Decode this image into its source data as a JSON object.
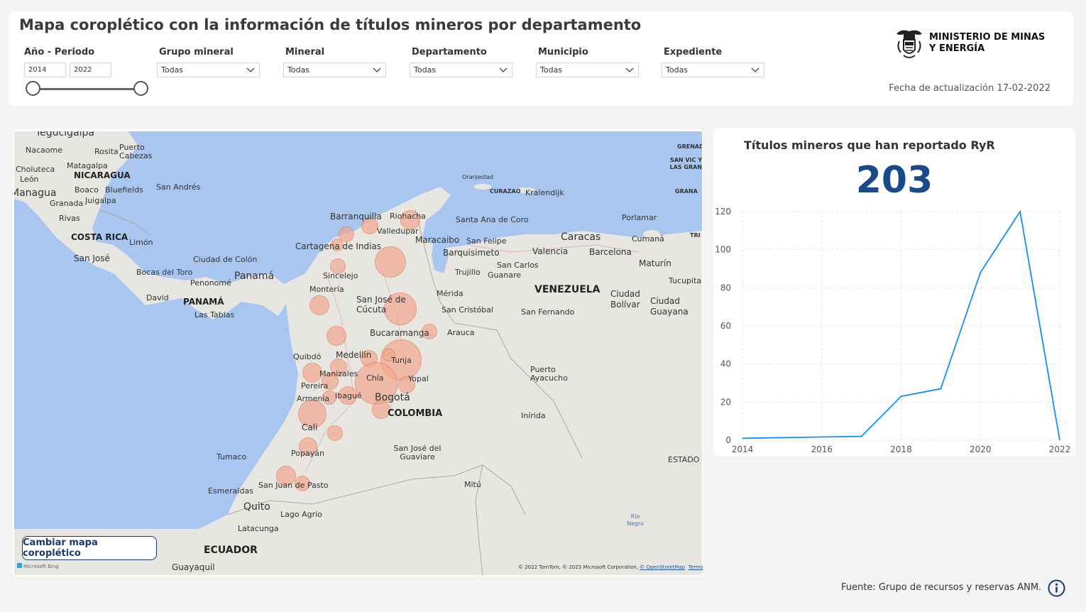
{
  "header": {
    "title": "Mapa coroplético con la información de títulos mineros por departamento",
    "ministry": "MINISTERIO DE MINAS Y ENERGÍA",
    "ministry_line1": "MINISTERIO DE MINAS",
    "ministry_line2": "Y ENERGÍA",
    "update_date": "Fecha de actualización 17-02-2022"
  },
  "filters": {
    "period_label": "Año - Periodo",
    "period_from": "2014",
    "period_to": "2022",
    "grupo_label": "Grupo mineral",
    "grupo_value": "Todas",
    "mineral_label": "Mineral",
    "mineral_value": "Todas",
    "departamento_label": "Departamento",
    "departamento_value": "Todas",
    "municipio_label": "Municipio",
    "municipio_value": "Todas",
    "expediente_label": "Expediente",
    "expediente_value": "Todas"
  },
  "map": {
    "switch_button": "Cambiar mapa coroplético",
    "bing_label": "Microsoft Bing",
    "attribution": "© 2022 TomTom, © 2023 Microsoft Corporation,",
    "osm_link": "© OpenStreetMap",
    "terms_link": "Terms",
    "bubble_color": "#f4a58a",
    "labels": {
      "tegucigalpa": "Tegucigalpa",
      "nacaome": "Nacaome",
      "rosita": "Rosita",
      "puerto_cabezas": "Puerto Cabezas",
      "choluteca": "Choluteca",
      "matagalpa": "Matagalpa",
      "leon": "León",
      "nicaragua": "NICARAGUA",
      "managua": "Managua",
      "boaco": "Boaco",
      "bluefields": "Bluefields",
      "san_andres": "San Andrés",
      "granada": "Granada",
      "juigalpa": "Juigalpa",
      "rivas": "Rivas",
      "costa_rica": "COSTA RICA",
      "limon": "Limón",
      "san_jose_cr": "San José",
      "ciudad_colon": "Ciudad de Colón",
      "bocas": "Bocas del Toro",
      "panama_city": "Panamá",
      "penonome": "Penonomé",
      "david": "David",
      "panama": "PANAMÁ",
      "las_tablas": "Las Tablas",
      "oranjestad": "Oranjestad",
      "curazao": "CURAZAO",
      "kralendijk": "Kralendijk",
      "barranquilla": "Barranquilla",
      "riohacha": "Riohacha",
      "valledupar": "Valledupar",
      "santa_ana": "Santa Ana de Coro",
      "maracaibo": "Maracaibo",
      "cartagena": "Cartagena de Indias",
      "san_felipe": "San Felipe",
      "barquisimeto": "Barquisimeto",
      "caracas": "Caracas",
      "valencia": "Valencia",
      "barcelona": "Barcelona",
      "cumana": "Cumaná",
      "porlamar": "Porlamar",
      "sincelejo": "Sincelejo",
      "san_carlos": "San Carlos",
      "trujillo": "Trujillo",
      "guanare": "Guanare",
      "maturin": "Maturín",
      "monteria": "Montería",
      "merida": "Mérida",
      "venezuela": "VENEZUELA",
      "ciudad_bolivar": "Ciudad Bolívar",
      "tucupita": "Tucupita",
      "ciudad_guayana": "Ciudad Guayana",
      "san_jose_cucuta": "San José de Cúcuta",
      "san_cristobal": "San Cristóbal",
      "san_fernando": "San Fernando",
      "bucaramanga": "Bucaramanga",
      "arauca": "Arauca",
      "quibdo": "Quibdó",
      "medellin": "Medellín",
      "tunja": "Tunja",
      "manizales": "Manizales",
      "puerto_ayacucho": "Puerto Ayacucho",
      "pereira": "Pereira",
      "chia": "Chía",
      "yopal": "Yopal",
      "armenia": "Armenia",
      "ibague": "Ibagué",
      "bogota": "Bogotá",
      "colombia": "COLOMBIA",
      "inirida": "Inírida",
      "cali": "Cali",
      "tumaco": "Tumaco",
      "popayan": "Popayán",
      "san_jose_guaviare": "San José del Guaviare",
      "estado": "ESTADO",
      "pasto": "San Juan de Pasto",
      "mitu": "Mitú",
      "esmeraldas": "Esmeraldas",
      "quito": "Quito",
      "lago_agrio": "Lago Agrio",
      "rio_negro": "Río Negro",
      "latacunga": "Latacunga",
      "ecuador": "ECUADOR",
      "guayaquil": "Guayaquil",
      "san_vicente": "SAN VIC Y LAS GRAN",
      "granada_isl": "GRANA",
      "grenada": "GRENADA",
      "trinidad": "TRI"
    }
  },
  "chart": {
    "title": "Títulos mineros que han reportado RyR",
    "kpi_value": "203",
    "line_color": "#118dff"
  },
  "chart_data": {
    "type": "line",
    "title": "Títulos mineros que han reportado RyR",
    "x": [
      2014,
      2017,
      2018,
      2019,
      2020,
      2021,
      2022
    ],
    "series": [
      {
        "values": [
          1,
          2,
          23,
          27,
          88,
          120,
          0
        ]
      }
    ],
    "xticks": [
      "2014",
      "2016",
      "2018",
      "2020",
      "2022"
    ],
    "yticks": [
      "0",
      "20",
      "40",
      "60",
      "80",
      "100",
      "120"
    ],
    "xlim": [
      2014,
      2022
    ],
    "ylim": [
      0,
      120
    ],
    "grid": true
  },
  "footer": {
    "source": "Fuente: Grupo de recursos y reservas ANM."
  }
}
